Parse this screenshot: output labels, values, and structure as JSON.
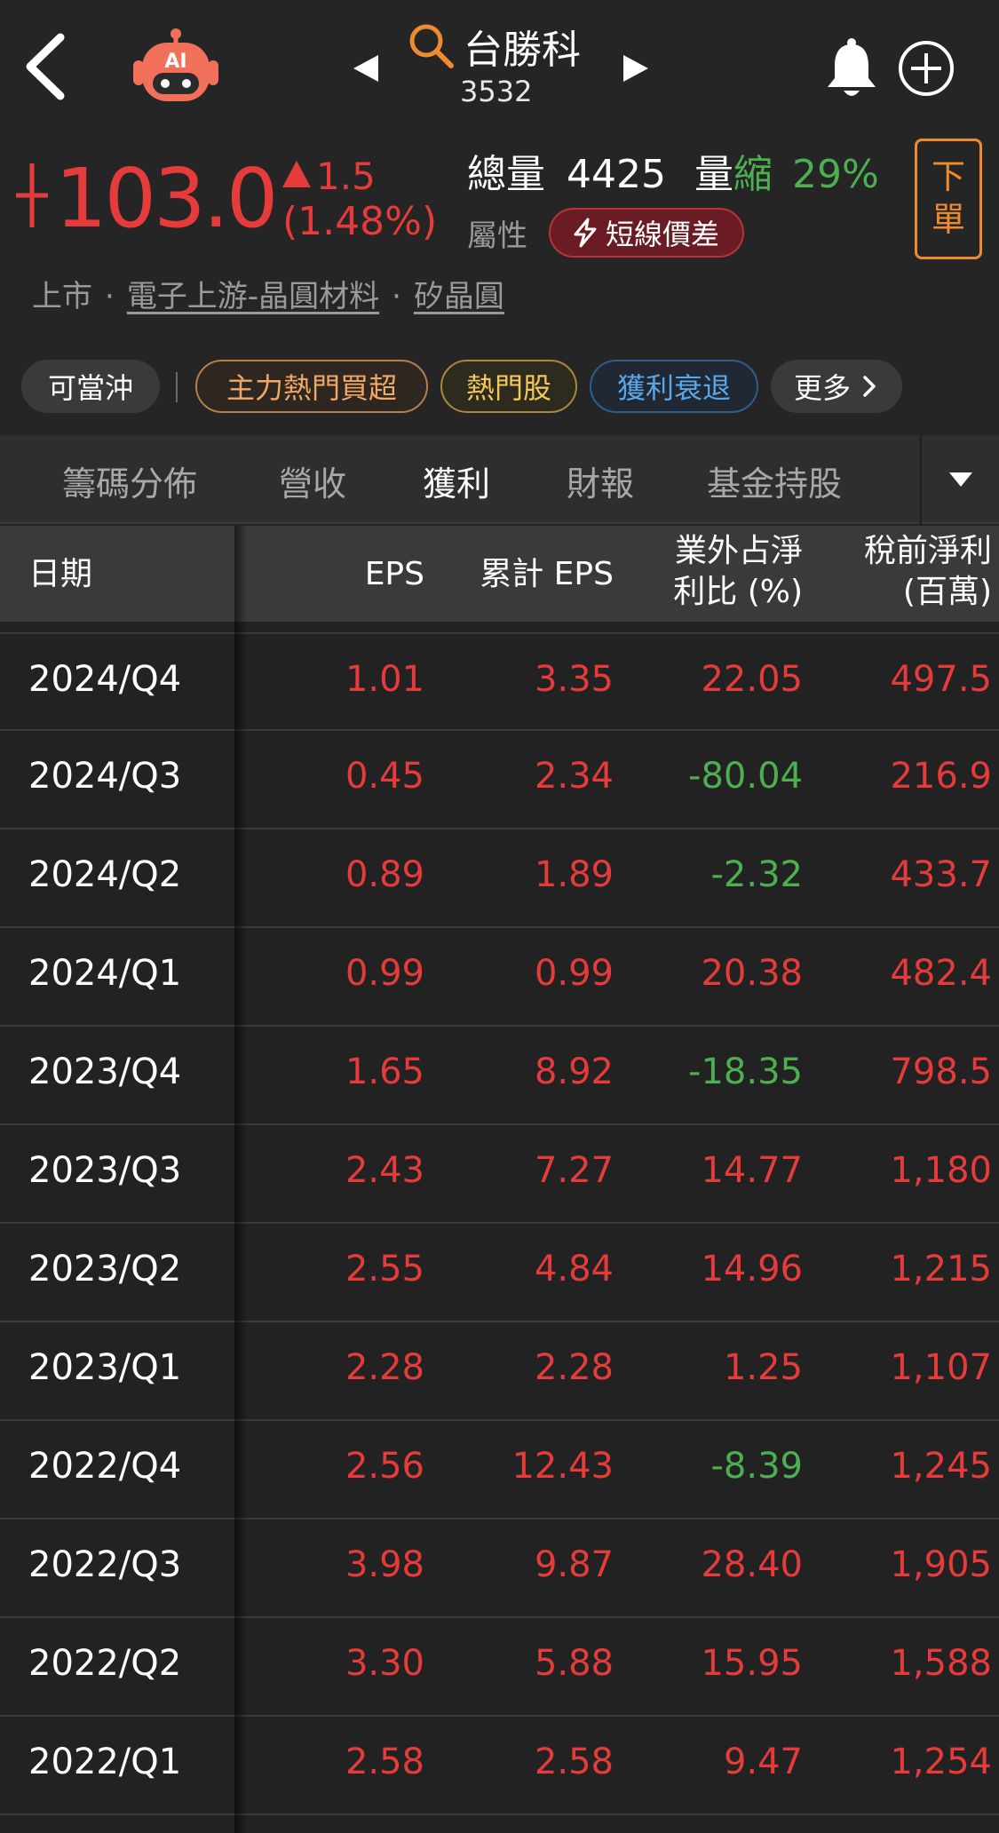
{
  "header": {
    "stock_name": "台勝科",
    "stock_code": "3532",
    "ai_label": "AI"
  },
  "quote": {
    "price": "103.0",
    "change": "1.5",
    "change_pct": "(1.48%)",
    "volume_label": "總量",
    "volume": "4425",
    "vol_change_label1": "量",
    "vol_change_label2": "縮",
    "vol_change_pct": "29%",
    "attr_label": "屬性",
    "attr_badge": "短線價差",
    "order_btn_line1": "下",
    "order_btn_line2": "單",
    "market": "上市",
    "industry": "電子上游-晶圓材料",
    "sub_industry": "矽晶圓"
  },
  "tags": {
    "daytrade": "可當沖",
    "main_force": "主力熱門買超",
    "hot": "熱門股",
    "decline": "獲利衰退",
    "more": "更多"
  },
  "tabs": [
    "籌碼分佈",
    "營收",
    "獲利",
    "財報",
    "基金持股"
  ],
  "active_tab": "獲利",
  "table": {
    "headers": {
      "date": "日期",
      "eps": "EPS",
      "cum_eps": "累計 EPS",
      "nonop_1": "業外占淨",
      "nonop_2": "利比 (%)",
      "pretax_1": "稅前淨利",
      "pretax_2": "(百萬)"
    },
    "rows": [
      {
        "date": "2024/Q4",
        "eps": "1.01",
        "cum": "3.35",
        "nonop": "22.05",
        "pretax": "497.5"
      },
      {
        "date": "2024/Q3",
        "eps": "0.45",
        "cum": "2.34",
        "nonop": "-80.04",
        "pretax": "216.9"
      },
      {
        "date": "2024/Q2",
        "eps": "0.89",
        "cum": "1.89",
        "nonop": "-2.32",
        "pretax": "433.7"
      },
      {
        "date": "2024/Q1",
        "eps": "0.99",
        "cum": "0.99",
        "nonop": "20.38",
        "pretax": "482.4"
      },
      {
        "date": "2023/Q4",
        "eps": "1.65",
        "cum": "8.92",
        "nonop": "-18.35",
        "pretax": "798.5"
      },
      {
        "date": "2023/Q3",
        "eps": "2.43",
        "cum": "7.27",
        "nonop": "14.77",
        "pretax": "1,180"
      },
      {
        "date": "2023/Q2",
        "eps": "2.55",
        "cum": "4.84",
        "nonop": "14.96",
        "pretax": "1,215"
      },
      {
        "date": "2023/Q1",
        "eps": "2.28",
        "cum": "2.28",
        "nonop": "1.25",
        "pretax": "1,107"
      },
      {
        "date": "2022/Q4",
        "eps": "2.56",
        "cum": "12.43",
        "nonop": "-8.39",
        "pretax": "1,245"
      },
      {
        "date": "2022/Q3",
        "eps": "3.98",
        "cum": "9.87",
        "nonop": "28.40",
        "pretax": "1,905"
      },
      {
        "date": "2022/Q2",
        "eps": "3.30",
        "cum": "5.88",
        "nonop": "15.95",
        "pretax": "1,588"
      },
      {
        "date": "2022/Q1",
        "eps": "2.58",
        "cum": "2.58",
        "nonop": "9.47",
        "pretax": "1,254"
      }
    ]
  },
  "colors": {
    "up": "#e53b3b",
    "down": "#4caf50",
    "accent_orange": "#ef8a2e",
    "background": "#222222"
  },
  "icons": [
    "back-arrow-icon",
    "ai-robot-icon",
    "search-icon",
    "prev-arrow-icon",
    "next-arrow-icon",
    "bell-icon",
    "plus-circle-icon",
    "lightning-icon",
    "chevron-right-icon",
    "triangle-down-icon"
  ]
}
